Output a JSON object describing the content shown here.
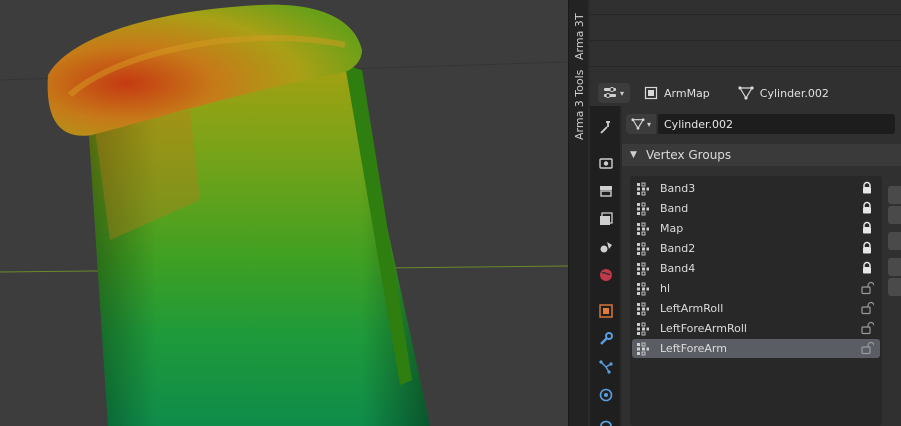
{
  "tabstrip": {
    "tabs": [
      {
        "label": "T"
      },
      {
        "label": "Arma 3"
      },
      {
        "label": "Arma 3 Tools"
      }
    ]
  },
  "header": {
    "object_name": "ArmMap",
    "mesh_name": "Cylinder.002",
    "object_icon": "object-data-icon",
    "mesh_icon": "mesh-data-icon"
  },
  "data_block": {
    "name": "Cylinder.002"
  },
  "vertex_groups": {
    "title": "Vertex Groups",
    "items": [
      {
        "label": "Band3",
        "locked": true,
        "selected": false
      },
      {
        "label": "Band",
        "locked": true,
        "selected": false
      },
      {
        "label": "Map",
        "locked": true,
        "selected": false
      },
      {
        "label": "Band2",
        "locked": true,
        "selected": false
      },
      {
        "label": "Band4",
        "locked": true,
        "selected": false
      },
      {
        "label": "hl",
        "locked": false,
        "selected": false
      },
      {
        "label": "LeftArmRoll",
        "locked": false,
        "selected": false
      },
      {
        "label": "LeftForeArmRoll",
        "locked": false,
        "selected": false
      },
      {
        "label": "LeftForeArm",
        "locked": false,
        "selected": true
      }
    ]
  },
  "property_tabs": [
    {
      "icon": "tool-icon"
    },
    {
      "icon": "render-icon"
    },
    {
      "icon": "output-icon"
    },
    {
      "icon": "view-layer-icon"
    },
    {
      "icon": "scene-icon"
    },
    {
      "icon": "world-icon"
    },
    {
      "icon": "object-icon"
    },
    {
      "icon": "modifier-wrench-icon"
    },
    {
      "icon": "particles-icon"
    },
    {
      "icon": "physics-icon"
    },
    {
      "icon": "constraints-icon"
    }
  ],
  "colors": {
    "selected_row": "#5a5d64",
    "panel_bg": "#303030",
    "viewport_bg": "#3d3d3d",
    "object_orange": "#e07b39"
  }
}
